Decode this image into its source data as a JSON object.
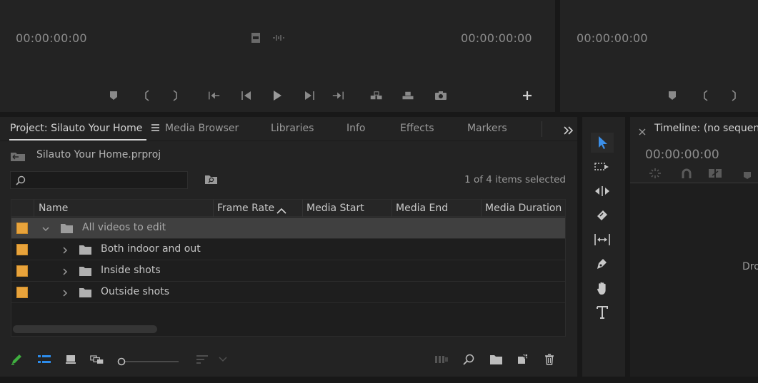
{
  "source_monitor": {
    "timecode_left": "00:00:00:00",
    "timecode_right": "00:00:00:00",
    "controls": [
      "marker-icon",
      "in-point-icon",
      "out-point-icon",
      "go-to-in-icon",
      "step-back-icon",
      "play-icon",
      "step-forward-icon",
      "go-to-out-icon",
      "insert-icon",
      "overwrite-icon",
      "export-frame-icon",
      "add-button-icon"
    ]
  },
  "program_monitor": {
    "timecode": "00:00:00:00"
  },
  "project_panel": {
    "tabs": [
      {
        "label": "Project: Silauto Your Home",
        "active": true
      },
      {
        "label": "Media Browser"
      },
      {
        "label": "Libraries"
      },
      {
        "label": "Info"
      },
      {
        "label": "Effects"
      },
      {
        "label": "Markers"
      }
    ],
    "project_file": "Silauto Your Home.prproj",
    "search_placeholder": "",
    "items_count": "1 of 4 items selected",
    "columns": [
      "Name",
      "Frame Rate",
      "Media Start",
      "Media End",
      "Media Duration"
    ],
    "rows": [
      {
        "name": "All videos to edit",
        "expanded": true,
        "selected": true,
        "label_color": "#e8a33b"
      },
      {
        "name": "Both indoor and out",
        "expanded": false,
        "selected": false,
        "label_color": "#e8a33b"
      },
      {
        "name": "Inside shots",
        "expanded": false,
        "selected": false,
        "label_color": "#e8a33b"
      },
      {
        "name": "Outside shots",
        "expanded": false,
        "selected": false,
        "label_color": "#e8a33b"
      }
    ]
  },
  "tools": [
    "selection-tool",
    "track-select-tool",
    "ripple-edit-tool",
    "razor-tool",
    "slip-tool",
    "pen-tool",
    "hand-tool",
    "type-tool"
  ],
  "timeline": {
    "title": "Timeline: (no sequence",
    "timecode": "00:00:00:00",
    "drop_hint": "Dro"
  },
  "colors": {
    "accent_blue": "#2d8ceb",
    "label_orange": "#e8a33b",
    "pencil_green": "#3fae3f"
  }
}
